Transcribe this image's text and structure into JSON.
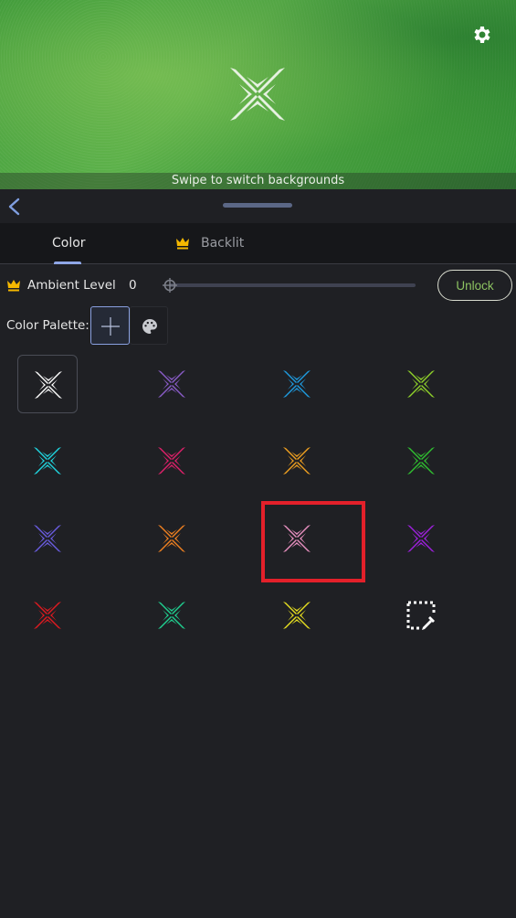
{
  "hero": {
    "caption": "Swipe to switch backgrounds",
    "logo_icon": "x-logo-icon",
    "settings_icon": "gear-icon"
  },
  "topbar": {
    "back_icon": "chevron-left-icon",
    "handle": "drag-handle"
  },
  "tabs": [
    {
      "label": "Color",
      "active": true,
      "premium": false
    },
    {
      "label": "Backlit",
      "active": false,
      "premium": true
    }
  ],
  "ambient": {
    "label": "Ambient Level",
    "value": "0",
    "slider_fraction": 0,
    "unlock_label": "Unlock",
    "premium_icon": "crown-icon"
  },
  "palette": {
    "label": "Color Palette:",
    "add_icon": "plus-icon",
    "paint_icon": "palette-icon"
  },
  "colors": {
    "accent": "#8fa6e6",
    "crown": "#f5b800",
    "unlock_text": "#8cc261",
    "highlight": "#e3202a"
  },
  "swatches": [
    {
      "name": "white",
      "color": "#ffffff",
      "selected": true
    },
    {
      "name": "purple",
      "color": "#8a5cc8"
    },
    {
      "name": "blue",
      "color": "#1f9be0"
    },
    {
      "name": "lime",
      "color": "#8fd12a"
    },
    {
      "name": "cyan",
      "color": "#20d6e0"
    },
    {
      "name": "magenta",
      "color": "#e0206a"
    },
    {
      "name": "amber",
      "color": "#f0a020"
    },
    {
      "name": "green",
      "color": "#30c030"
    },
    {
      "name": "indigo",
      "color": "#6a5ce0"
    },
    {
      "name": "orange",
      "color": "#f08020"
    },
    {
      "name": "pink",
      "color": "#e890c0",
      "highlighted": true
    },
    {
      "name": "violet",
      "color": "#a020e0"
    },
    {
      "name": "red",
      "color": "#e01a20"
    },
    {
      "name": "teal",
      "color": "#20d090"
    },
    {
      "name": "yellow",
      "color": "#e8e020"
    },
    {
      "name": "custom",
      "icon": "eyedropper-icon"
    }
  ]
}
